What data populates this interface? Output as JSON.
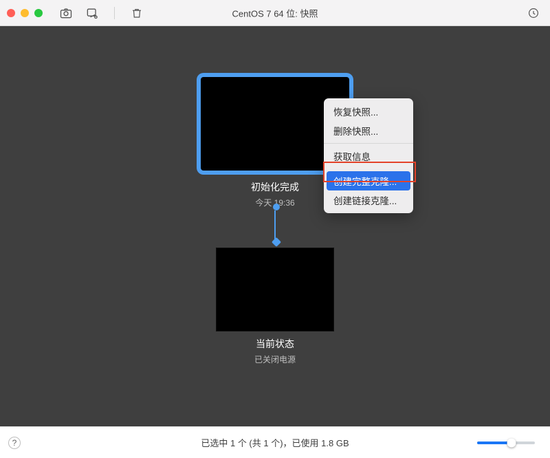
{
  "window": {
    "title": "CentOS 7 64 位: 快照"
  },
  "toolbar": {
    "icons": [
      "camera",
      "snapshot",
      "trash",
      "clock"
    ]
  },
  "snapshots": {
    "selected": {
      "title": "初始化完成",
      "timestamp": "今天 19:36"
    },
    "current": {
      "title": "当前状态",
      "sub": "已关闭电源"
    }
  },
  "context_menu": {
    "items": [
      {
        "label": "恢复快照..."
      },
      {
        "label": "删除快照..."
      },
      {
        "label": "获取信息"
      },
      {
        "label": "创建完整克隆...",
        "selected": true
      },
      {
        "label": "创建链接克隆..."
      }
    ]
  },
  "status": {
    "text": "已选中 1 个 (共 1 个)，已使用 1.8 GB"
  }
}
